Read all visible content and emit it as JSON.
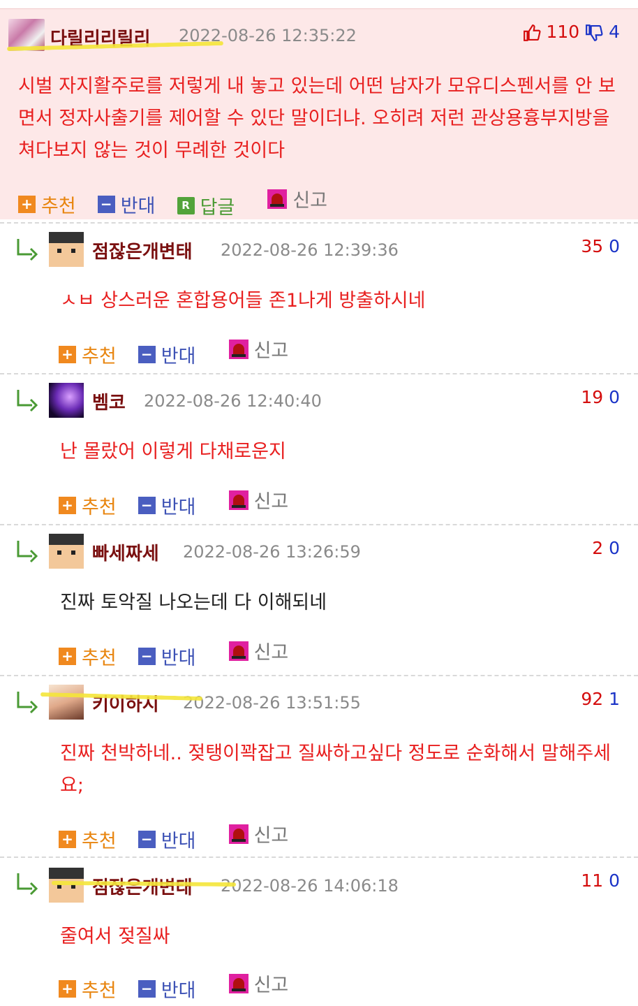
{
  "top": {
    "nickname": "다릴리리릴리",
    "date": "2022-08-26 12:35:22",
    "up": "110",
    "down": "4",
    "body": "시벌 자지활주로를 저렇게 내 놓고 있는데 어떤 남자가 모유디스펜서를 안 보면서 정자사출기를 제어할 수 있단 말이더냐. 오히려 저런 관상용흉부지방을 쳐다보지 않는 것이 무례한 것이다",
    "actions": {
      "recommend": "추천",
      "oppose": "반대",
      "reply": "답글",
      "report": "신고"
    }
  },
  "replies": [
    {
      "nickname": "점잖은개변태",
      "date": "2022-08-26 12:39:36",
      "up": "35",
      "down": "0",
      "body": "ㅅㅂ 상스러운 혼합용어들 존1나게 방출하시네",
      "color": "red"
    },
    {
      "nickname": "벰코",
      "date": "2022-08-26 12:40:40",
      "up": "19",
      "down": "0",
      "body": "난 몰랐어 이렇게 다채로운지",
      "color": "red"
    },
    {
      "nickname": "빠세짜세",
      "date": "2022-08-26 13:26:59",
      "up": "2",
      "down": "0",
      "body": "진짜 토악질 나오는데 다 이해되네",
      "color": "black"
    },
    {
      "nickname": "키이하시",
      "date": "2022-08-26 13:51:55",
      "up": "92",
      "down": "1",
      "body": "진짜 천박하네.. 젖탱이꽉잡고 질싸하고싶다 정도로 순화해서 말해주세요;",
      "color": "red"
    },
    {
      "nickname": "점잖은개변태",
      "date": "2022-08-26 14:06:18",
      "up": "11",
      "down": "0",
      "body": "줄여서 젖질싸",
      "color": "red"
    }
  ],
  "reply_actions": {
    "recommend": "추천",
    "oppose": "반대",
    "report": "신고"
  },
  "colors": {
    "accent_red": "#e81f1f",
    "nick": "#7a1010",
    "top_bg": "#fde8e8",
    "up": "#d40d0d",
    "down": "#1a33c7"
  },
  "icons": {
    "like": "thumbs-up-icon",
    "dislike": "thumbs-down-icon",
    "reply_arrow": "reply-arrow-icon",
    "report": "siren-icon"
  }
}
